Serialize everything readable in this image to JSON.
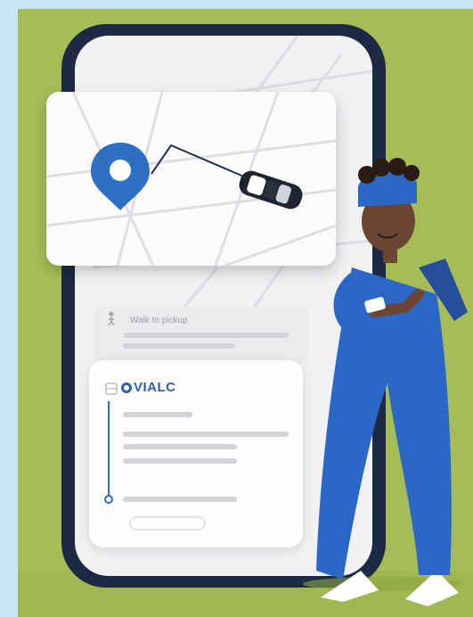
{
  "walk_label": "Walk to pickup",
  "brand_name": "VIALC",
  "colors": {
    "background_green": "#a6bd57",
    "phone_frame": "#1c2a44",
    "pin_blue": "#2f6fc1",
    "person_blue": "#2b67c4",
    "skin": "#6b4634"
  },
  "icons": [
    "location-pin-icon",
    "car-icon",
    "walking-person-icon",
    "via-logo-icon"
  ]
}
